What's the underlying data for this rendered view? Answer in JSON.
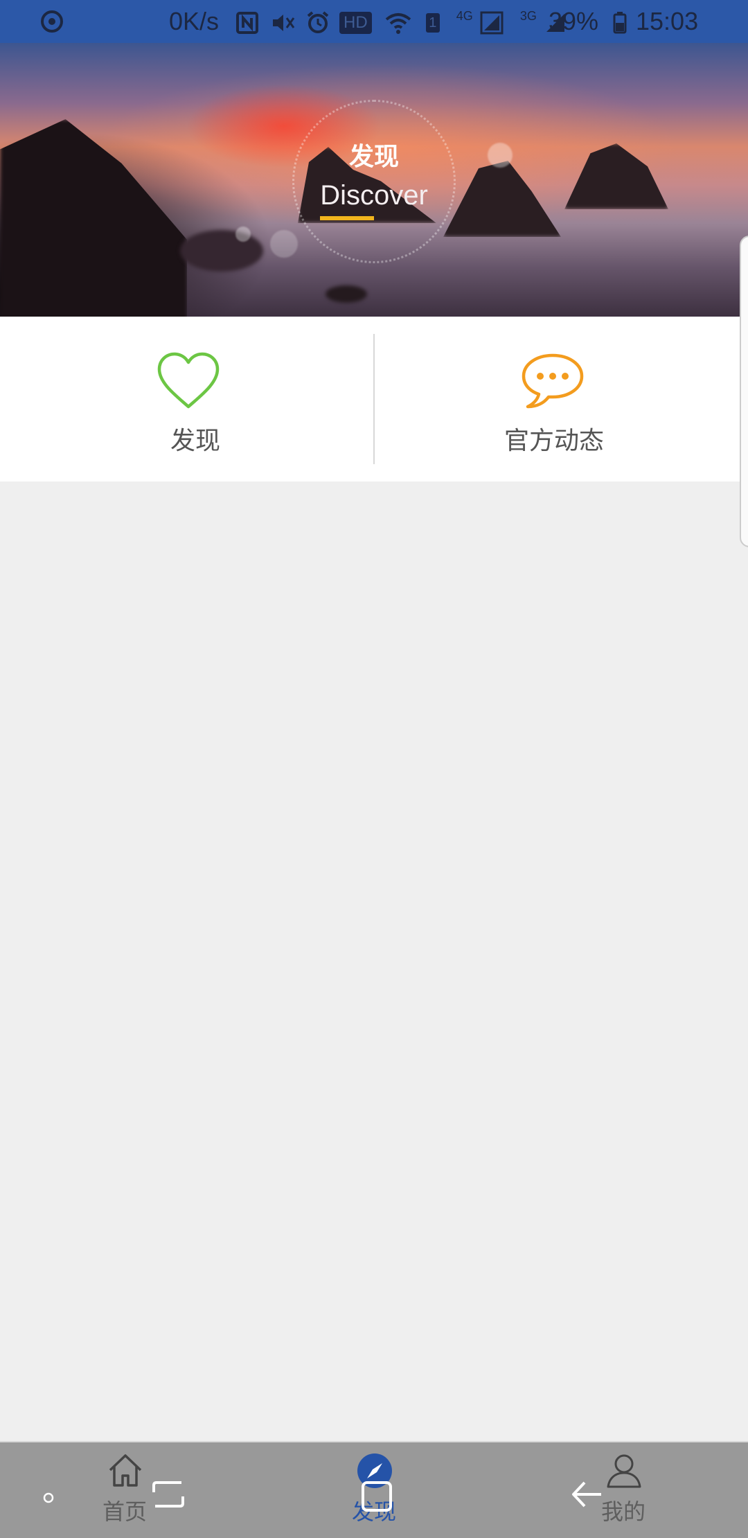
{
  "status_bar": {
    "net_speed": "0K/s",
    "hd_label": "HD",
    "sim_label": "1",
    "net_4g": "4G",
    "net_3g": "3G",
    "battery_percent": "39%",
    "time": "15:03"
  },
  "banner": {
    "title": "发现",
    "subtitle": "Discover"
  },
  "menu": {
    "items": [
      {
        "label": "发现",
        "icon": "heart-icon",
        "color": "#6cc644"
      },
      {
        "label": "官方动态",
        "icon": "chat-bubble-icon",
        "color": "#f39c1e"
      }
    ]
  },
  "tab_bar": {
    "tabs": [
      {
        "label": "首页",
        "icon": "home-icon"
      },
      {
        "label": "发现",
        "icon": "compass-icon",
        "active": true
      },
      {
        "label": "我的",
        "icon": "user-icon"
      }
    ],
    "active_color": "#2553a8"
  },
  "colors": {
    "status_bar_bg": "#2c58a8",
    "page_bg": "#efefef",
    "accent_underline": "#f2b51d"
  }
}
